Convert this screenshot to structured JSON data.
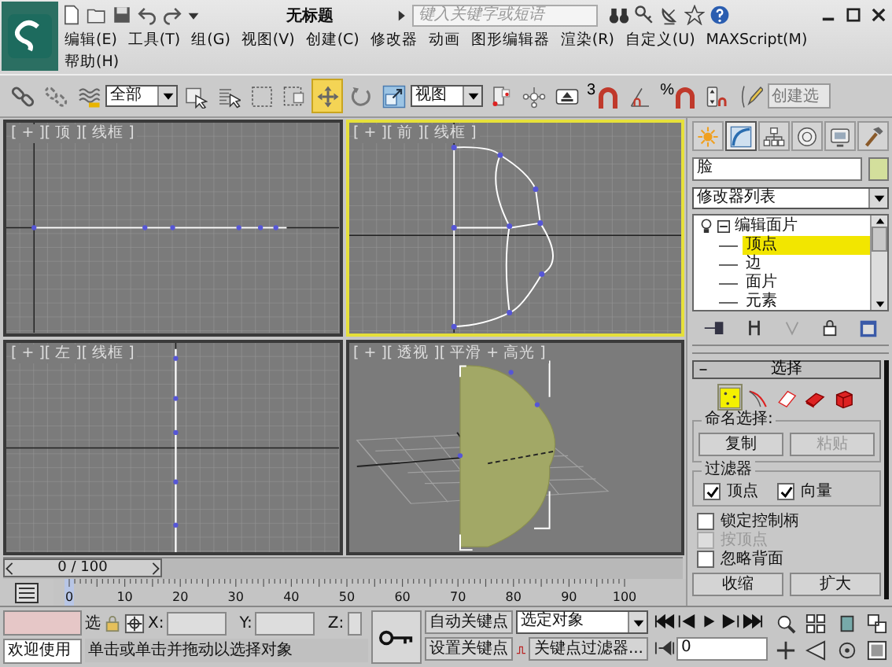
{
  "title_bar": {
    "title": "无标题",
    "search": {
      "placeholder": "键入关键字或短语"
    }
  },
  "menu": [
    "编辑(E)",
    "工具(T)",
    "组(G)",
    "视图(V)",
    "创建(C)",
    "修改器",
    "动画",
    "图形编辑器",
    "渲染(R)",
    "自定义(U)",
    "MAXScript(M)",
    "帮助(H)"
  ],
  "toolbar": {
    "items": [
      {
        "kind": "tool",
        "selected": false
      },
      {
        "kind": "tool",
        "selected": false
      },
      {
        "kind": "tool",
        "selected": false
      },
      {
        "kind": "dropdown",
        "value": "全部"
      },
      {
        "kind": "tool",
        "selected": false
      },
      {
        "kind": "tool",
        "selected": false
      },
      {
        "kind": "tool",
        "selected": false
      },
      {
        "kind": "tool",
        "selected": false
      },
      {
        "kind": "tool",
        "selected": true
      },
      {
        "kind": "tool",
        "selected": false
      },
      {
        "kind": "tool",
        "selected": false
      },
      {
        "kind": "dropdown",
        "value": "视图"
      },
      {
        "kind": "tool",
        "selected": false
      },
      {
        "kind": "tool",
        "selected": false
      },
      {
        "kind": "tool",
        "selected": false
      },
      {
        "kind": "tool",
        "selected": false,
        "label": "3"
      },
      {
        "kind": "tool",
        "selected": false
      },
      {
        "kind": "tool",
        "selected": false,
        "label": "%"
      },
      {
        "kind": "tool",
        "selected": false
      },
      {
        "kind": "tool",
        "selected": false
      },
      {
        "kind": "field",
        "placeholder": "创建选"
      }
    ]
  },
  "viewports": [
    {
      "kind": "top",
      "label": "[ + ][ 顶 ][ 线框 ]",
      "active": false
    },
    {
      "kind": "front",
      "label": "[ + ][ 前 ][ 线框 ]",
      "active": true
    },
    {
      "kind": "left",
      "label": "[ + ][ 左 ][ 线框 ]",
      "active": false
    },
    {
      "kind": "perspective",
      "label": "[ + ][ 透视 ][ 平滑 + 高光 ]",
      "active": false
    }
  ],
  "command_panel": {
    "tabs": [
      {
        "selected": false
      },
      {
        "selected": true
      },
      {
        "selected": false
      },
      {
        "selected": false
      },
      {
        "selected": false
      },
      {
        "selected": false
      }
    ],
    "object_name": "脸",
    "modifier_list": "修改器列表",
    "stack": [
      {
        "label": "编辑面片",
        "expanded": true,
        "children": [
          {
            "label": "顶点",
            "selected": true
          },
          {
            "label": "边",
            "selected": false
          },
          {
            "label": "面片",
            "selected": false
          },
          {
            "label": "元素",
            "selected": false
          }
        ]
      }
    ],
    "rollout": {
      "title": "选择",
      "expanded": true,
      "levels": [
        {
          "selected": true
        },
        {
          "selected": false
        },
        {
          "selected": false
        },
        {
          "selected": false
        },
        {
          "selected": false
        }
      ],
      "named_selection": {
        "label": "命名选择:",
        "buttons": [
          {
            "label": "复制",
            "disabled": false
          },
          {
            "label": "粘贴",
            "disabled": true
          }
        ]
      },
      "filter": {
        "label": "过滤器",
        "options": [
          {
            "label": "顶点",
            "checked": true
          },
          {
            "label": "向量",
            "checked": true
          }
        ]
      },
      "options": [
        {
          "label": "锁定控制柄",
          "checked": false,
          "disabled": false
        },
        {
          "label": "按顶点",
          "checked": false,
          "disabled": true
        },
        {
          "label": "忽略背面",
          "checked": false,
          "disabled": false
        }
      ],
      "buttons": [
        "收缩",
        "扩大"
      ]
    }
  },
  "time_slider": {
    "label": "0 / 100",
    "level": 0
  },
  "track": {
    "ticks": [
      "0",
      "10",
      "20",
      "30",
      "40",
      "50",
      "60",
      "70",
      "80",
      "90",
      "100"
    ]
  },
  "status_bar": {
    "listener": "欢迎使用",
    "selection_label": "选",
    "x_label": "X:",
    "y_label": "Y:",
    "z_label": "Z:",
    "prompt": "单击或单击并拖动以选择对象",
    "auto_key": "自动关键点",
    "set_key": "设置关键点",
    "key_mode": "选定对象",
    "key_filters": "关键点过滤器...",
    "frame": "0"
  }
}
